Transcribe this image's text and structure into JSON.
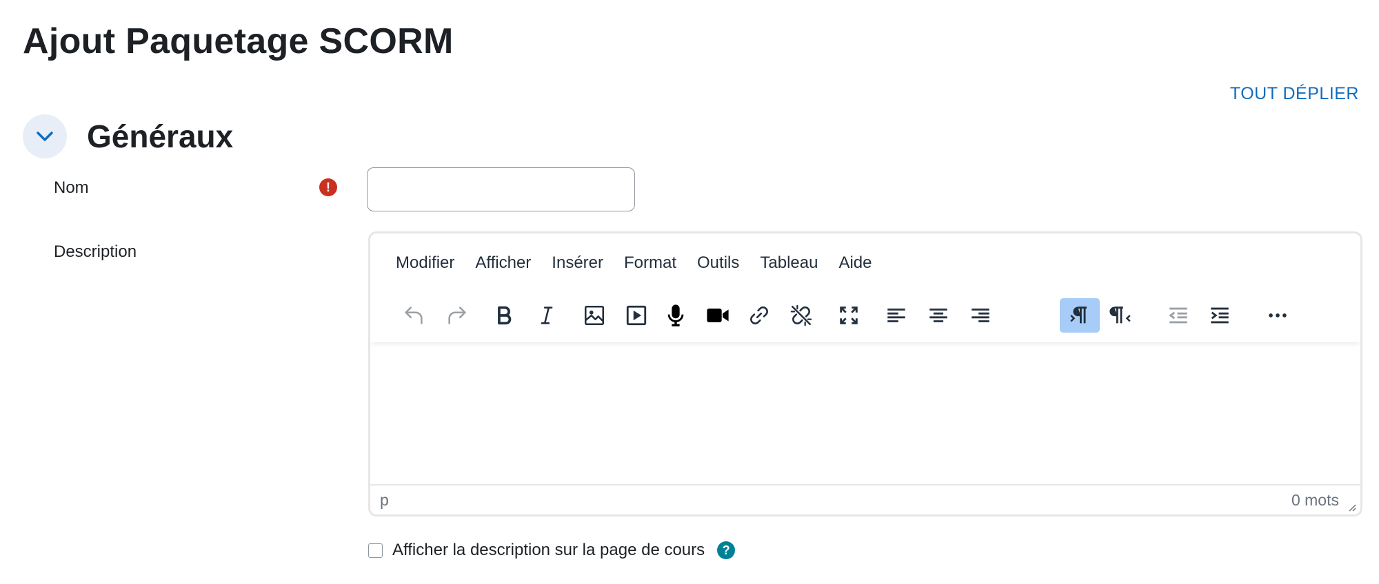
{
  "page": {
    "title": "Ajout Paquetage SCORM"
  },
  "expand_all": {
    "label": "TOUT DÉPLIER"
  },
  "section": {
    "title": "Généraux",
    "collapse_icon": "chevron-down-icon"
  },
  "fields": {
    "name": {
      "label": "Nom",
      "value": "",
      "placeholder": "",
      "required_icon": "exclamation-circle-icon",
      "required_glyph": "!"
    },
    "description": {
      "label": "Description"
    }
  },
  "editor": {
    "menus": [
      "Modifier",
      "Afficher",
      "Insérer",
      "Format",
      "Outils",
      "Tableau",
      "Aide"
    ],
    "toolbar": [
      {
        "icon": "undo-icon",
        "disabled": true
      },
      {
        "icon": "redo-icon",
        "disabled": true
      },
      {
        "icon": "bold-icon",
        "disabled": false
      },
      {
        "icon": "italic-icon",
        "disabled": false
      },
      {
        "icon": "image-icon",
        "disabled": false
      },
      {
        "icon": "media-icon",
        "disabled": false
      },
      {
        "icon": "microphone-icon",
        "disabled": false
      },
      {
        "icon": "video-camera-icon",
        "disabled": false
      },
      {
        "icon": "link-icon",
        "disabled": false
      },
      {
        "icon": "unlink-icon",
        "disabled": false
      },
      {
        "icon": "fullscreen-icon",
        "disabled": false
      },
      {
        "icon": "align-left-icon",
        "disabled": false
      },
      {
        "icon": "align-center-icon",
        "disabled": false
      },
      {
        "icon": "align-right-icon",
        "disabled": false
      },
      {
        "icon": "ltr-icon",
        "disabled": false,
        "active": true
      },
      {
        "icon": "rtl-icon",
        "disabled": false
      },
      {
        "icon": "outdent-icon",
        "disabled": true
      },
      {
        "icon": "indent-icon",
        "disabled": false
      },
      {
        "icon": "more-icon",
        "disabled": false
      }
    ],
    "status_path": "p",
    "word_count": "0 mots"
  },
  "show_description": {
    "label": "Afficher la description sur la page de cours",
    "checked": false,
    "help_icon": "question-circle-icon",
    "help_glyph": "?"
  },
  "colors": {
    "accent": "#0f6cbf",
    "required": "#ca3120",
    "help": "#008196",
    "active_button": "#a6ccf7",
    "text": "#1d2125"
  }
}
